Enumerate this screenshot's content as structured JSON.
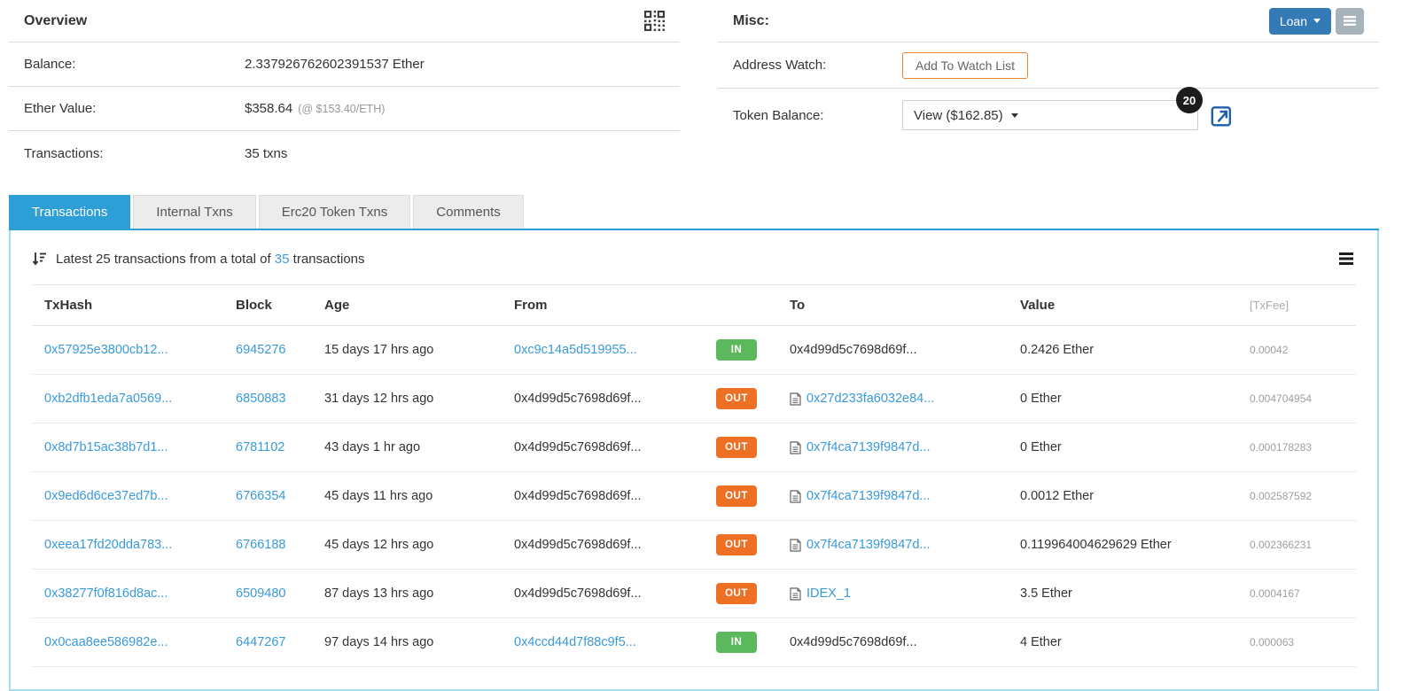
{
  "colors": {
    "link_blue": "#3a9ad9",
    "tab_blue": "#2e9ed7",
    "in_green": "#5cb85c",
    "out_orange": "#ed7025",
    "loan_blue": "#337ab7",
    "watch_orange": "#e8832e"
  },
  "overview": {
    "title": "Overview",
    "rows": [
      {
        "label": "Balance:",
        "value": "2.337926762602391537 Ether",
        "note": ""
      },
      {
        "label": "Ether Value:",
        "value": "$358.64",
        "note": "(@ $153.40/ETH)"
      },
      {
        "label": "Transactions:",
        "value": "35 txns",
        "note": ""
      }
    ]
  },
  "misc": {
    "title": "Misc:",
    "loan_button": "Loan",
    "address_watch_label": "Address Watch:",
    "add_watch_button": "Add To Watch List",
    "token_balance_label": "Token Balance:",
    "token_dropdown_value": "View ($162.85)",
    "token_count_badge": "20"
  },
  "tabs": [
    {
      "label": "Transactions",
      "active": true
    },
    {
      "label": "Internal Txns",
      "active": false
    },
    {
      "label": "Erc20 Token Txns",
      "active": false
    },
    {
      "label": "Comments",
      "active": false
    }
  ],
  "table": {
    "summary_prefix": "Latest 25 transactions from a total of ",
    "summary_total": "35",
    "summary_suffix": " transactions",
    "headers": [
      "TxHash",
      "Block",
      "Age",
      "From",
      "",
      "To",
      "Value",
      "[TxFee]"
    ],
    "rows": [
      {
        "txhash": "0x57925e3800cb12...",
        "block": "6945276",
        "age": "15 days 17 hrs ago",
        "from": "0xc9c14a5d519955...",
        "from_link": true,
        "dir": "IN",
        "to": "0x4d99d5c7698d69f...",
        "to_link": false,
        "to_contract": false,
        "value": "0.2426 Ether",
        "fee": "0.00042"
      },
      {
        "txhash": "0xb2dfb1eda7a0569...",
        "block": "6850883",
        "age": "31 days 12 hrs ago",
        "from": "0x4d99d5c7698d69f...",
        "from_link": false,
        "dir": "OUT",
        "to": "0x27d233fa6032e84...",
        "to_link": true,
        "to_contract": true,
        "value": "0 Ether",
        "fee": "0.004704954"
      },
      {
        "txhash": "0x8d7b15ac38b7d1...",
        "block": "6781102",
        "age": "43 days 1 hr ago",
        "from": "0x4d99d5c7698d69f...",
        "from_link": false,
        "dir": "OUT",
        "to": "0x7f4ca7139f9847d...",
        "to_link": true,
        "to_contract": true,
        "value": "0 Ether",
        "fee": "0.000178283"
      },
      {
        "txhash": "0x9ed6d6ce37ed7b...",
        "block": "6766354",
        "age": "45 days 11 hrs ago",
        "from": "0x4d99d5c7698d69f...",
        "from_link": false,
        "dir": "OUT",
        "to": "0x7f4ca7139f9847d...",
        "to_link": true,
        "to_contract": true,
        "value": "0.0012 Ether",
        "fee": "0.002587592"
      },
      {
        "txhash": "0xeea17fd20dda783...",
        "block": "6766188",
        "age": "45 days 12 hrs ago",
        "from": "0x4d99d5c7698d69f...",
        "from_link": false,
        "dir": "OUT",
        "to": "0x7f4ca7139f9847d...",
        "to_link": true,
        "to_contract": true,
        "value": "0.119964004629629 Ether",
        "fee": "0.002366231"
      },
      {
        "txhash": "0x38277f0f816d8ac...",
        "block": "6509480",
        "age": "87 days 13 hrs ago",
        "from": "0x4d99d5c7698d69f...",
        "from_link": false,
        "dir": "OUT",
        "to": "IDEX_1",
        "to_link": true,
        "to_contract": true,
        "value": "3.5 Ether",
        "fee": "0.0004167"
      },
      {
        "txhash": "0x0caa8ee586982e...",
        "block": "6447267",
        "age": "97 days 14 hrs ago",
        "from": "0x4ccd44d7f88c9f5...",
        "from_link": true,
        "dir": "IN",
        "to": "0x4d99d5c7698d69f...",
        "to_link": false,
        "to_contract": false,
        "value": "4 Ether",
        "fee": "0.000063"
      }
    ]
  }
}
